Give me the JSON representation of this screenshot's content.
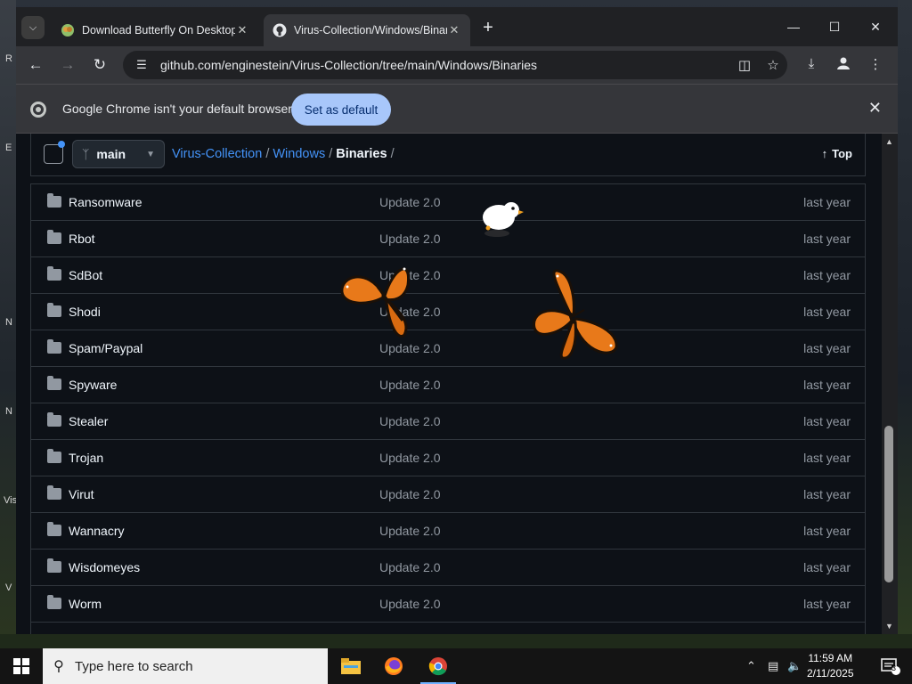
{
  "desktop": {
    "left_letters": [
      "R",
      "E",
      "N",
      "N",
      "Vis",
      "V"
    ]
  },
  "tabs": [
    {
      "title": "Download Butterfly On Desktop",
      "active": false
    },
    {
      "title": "Virus-Collection/Windows/Binaries",
      "active": true
    }
  ],
  "toolbar": {
    "url": "github.com/enginestein/Virus-Collection/tree/main/Windows/Binaries"
  },
  "infobar": {
    "message": "Google Chrome isn't your default browser",
    "button": "Set as default"
  },
  "repo_header": {
    "branch": "main",
    "crumbs": {
      "repo": "Virus-Collection",
      "sep1": "/",
      "folder": "Windows",
      "sep2": "/",
      "current": "Binaries",
      "sep3": "/"
    },
    "top_label": "Top"
  },
  "files": [
    {
      "name": "Ransomware",
      "message": "Update 2.0",
      "age": "last year"
    },
    {
      "name": "Rbot",
      "message": "Update 2.0",
      "age": "last year"
    },
    {
      "name": "SdBot",
      "message": "Update 2.0",
      "age": "last year"
    },
    {
      "name": "Shodi",
      "message": "Update 2.0",
      "age": "last year"
    },
    {
      "name": "Spam/Paypal",
      "message": "Update 2.0",
      "age": "last year"
    },
    {
      "name": "Spyware",
      "message": "Update 2.0",
      "age": "last year"
    },
    {
      "name": "Stealer",
      "message": "Update 2.0",
      "age": "last year"
    },
    {
      "name": "Trojan",
      "message": "Update 2.0",
      "age": "last year"
    },
    {
      "name": "Virut",
      "message": "Update 2.0",
      "age": "last year"
    },
    {
      "name": "Wannacry",
      "message": "Update 2.0",
      "age": "last year"
    },
    {
      "name": "Wisdomeyes",
      "message": "Update 2.0",
      "age": "last year"
    },
    {
      "name": "Worm",
      "message": "Update 2.0",
      "age": "last year"
    }
  ],
  "taskbar": {
    "search_placeholder": "Type here to search",
    "time": "11:59 AM",
    "date": "2/11/2025",
    "notifications": "3"
  }
}
